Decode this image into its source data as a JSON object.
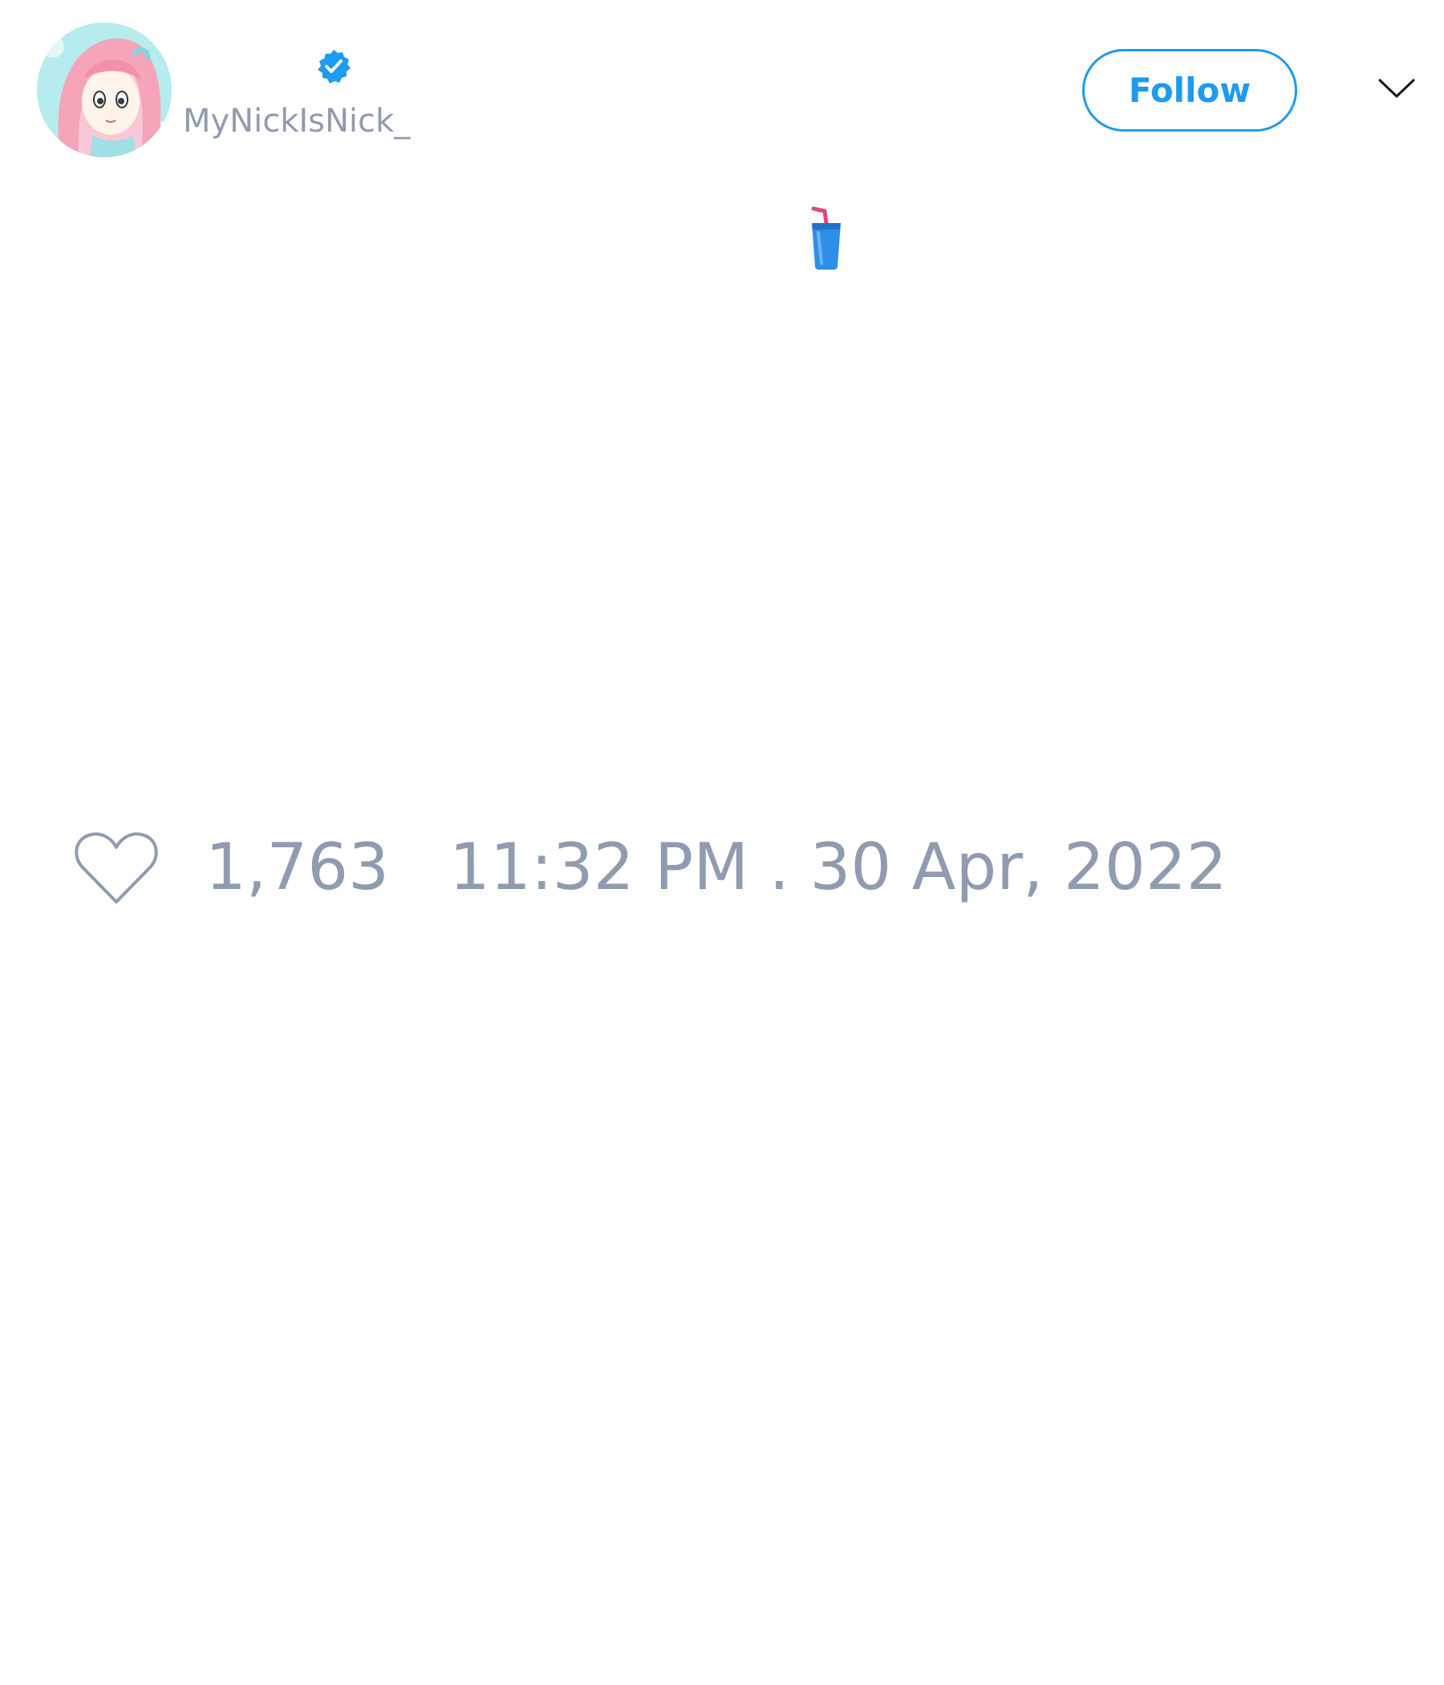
{
  "tweet": {
    "author": {
      "display_name": "",
      "handle": "MyNickIsNick_",
      "verified": true,
      "verified_icon": "verified-badge-icon",
      "avatar_icon": "avatar-image"
    },
    "follow_button_label": "Follow",
    "menu_icon": "chevron-down-icon",
    "text": "",
    "text_emoji_icon": "cup-with-straw-icon",
    "likes": {
      "icon": "heart-icon",
      "count": "1,763"
    },
    "timestamp": "11:32 PM . 30 Apr, 2022"
  },
  "colors": {
    "accent": "#1d9bf0",
    "muted_text": "#8f9bb0",
    "background": "#ffffff"
  }
}
